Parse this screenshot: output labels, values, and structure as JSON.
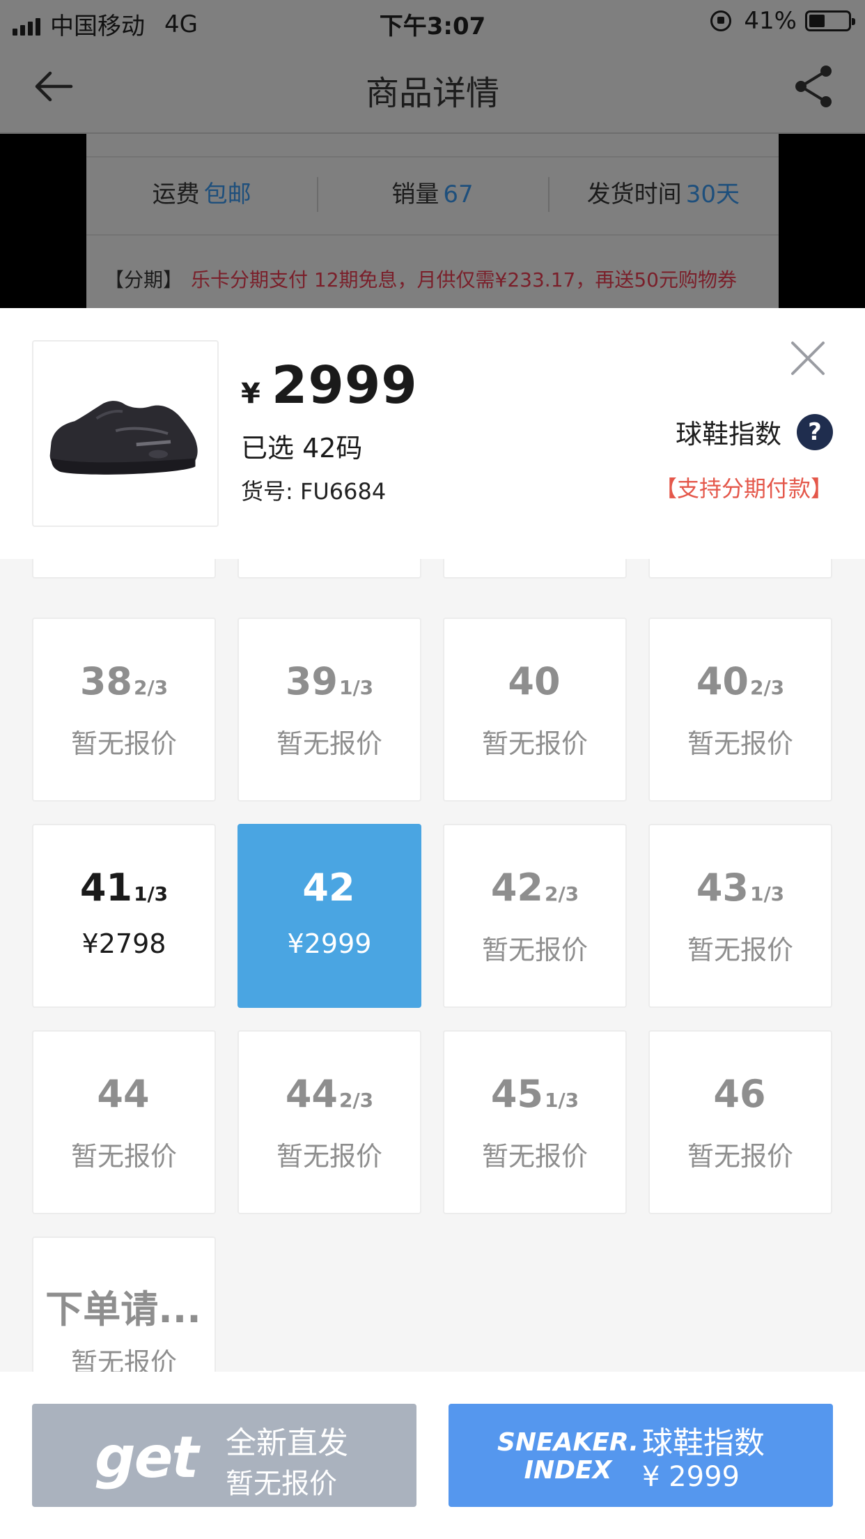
{
  "status_bar": {
    "carrier": "中国移动",
    "network": "4G",
    "time": "下午3:07",
    "battery": "41%",
    "battery_level": 0.41
  },
  "nav": {
    "title": "商品详情",
    "back_icon": "arrow-left-icon",
    "share_icon": "share-icon"
  },
  "detail": {
    "stats": [
      {
        "label": "运费",
        "value": "包邮"
      },
      {
        "label": "销量",
        "value": "67"
      },
      {
        "label": "发货时间",
        "value": "30天"
      }
    ],
    "installment_tag": "【分期】",
    "installment_text": "乐卡分期支付 12期免息，月供仅需¥233.17，再送50元购物券"
  },
  "sheet": {
    "currency": "¥",
    "price": "2999",
    "selected": "已选 42码",
    "sku": "货号: FU6684",
    "index_label": "球鞋指数",
    "help_icon": "?",
    "installment_note": "【支持分期付款】"
  },
  "sizes": [
    {
      "size": "38",
      "frac": "2/3",
      "price": "暂无报价",
      "state": "none"
    },
    {
      "size": "39",
      "frac": "1/3",
      "price": "暂无报价",
      "state": "none"
    },
    {
      "size": "40",
      "frac": "",
      "price": "暂无报价",
      "state": "none"
    },
    {
      "size": "40",
      "frac": "2/3",
      "price": "暂无报价",
      "state": "none"
    },
    {
      "size": "41",
      "frac": "1/3",
      "price": "¥2798",
      "state": "available"
    },
    {
      "size": "42",
      "frac": "",
      "price": "¥2999",
      "state": "selected"
    },
    {
      "size": "42",
      "frac": "2/3",
      "price": "暂无报价",
      "state": "none"
    },
    {
      "size": "43",
      "frac": "1/3",
      "price": "暂无报价",
      "state": "none"
    },
    {
      "size": "44",
      "frac": "",
      "price": "暂无报价",
      "state": "none"
    },
    {
      "size": "44",
      "frac": "2/3",
      "price": "暂无报价",
      "state": "none"
    },
    {
      "size": "45",
      "frac": "1/3",
      "price": "暂无报价",
      "state": "none"
    },
    {
      "size": "46",
      "frac": "",
      "price": "暂无报价",
      "state": "none"
    },
    {
      "size": "下单请...",
      "frac": "",
      "price": "暂无报价",
      "state": "none"
    }
  ],
  "footer": {
    "get": {
      "logo": "get",
      "line1": "全新直发",
      "line2": "暂无报价"
    },
    "index": {
      "logo_line1": "SNEAKER.",
      "logo_line2": "INDEX",
      "line1": "球鞋指数",
      "line2": "¥ 2999"
    }
  }
}
